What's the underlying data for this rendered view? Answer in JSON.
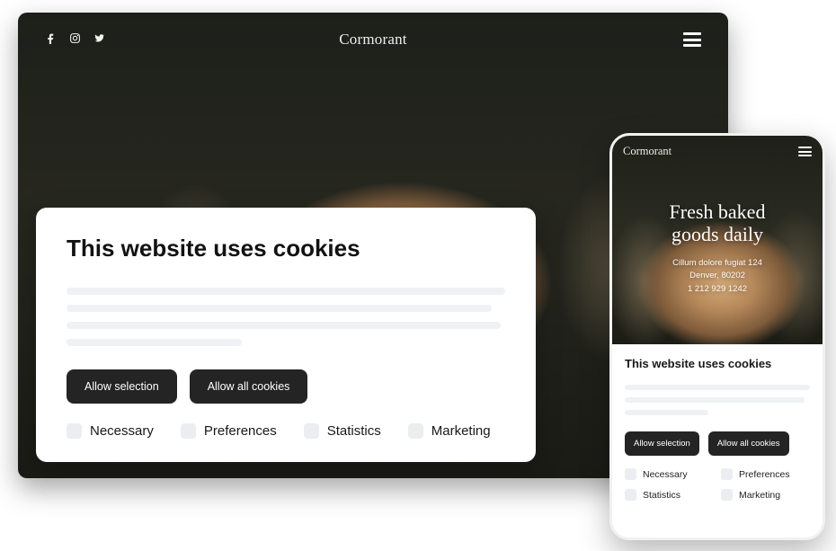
{
  "desktop": {
    "site_title": "Cormorant",
    "cookie": {
      "title": "This website uses cookies",
      "allow_selection": "Allow selection",
      "allow_all": "Allow all cookies",
      "categories": [
        "Necessary",
        "Preferences",
        "Statistics",
        "Marketing"
      ]
    }
  },
  "mobile": {
    "site_title": "Cormorant",
    "hero": {
      "line1": "Fresh baked",
      "line2": "goods daily",
      "address": "Cillum dolore fugiat 124",
      "city": "Denver, 80202",
      "phone": "1 212 929 1242"
    },
    "cookie": {
      "title": "This website uses cookies",
      "allow_selection": "Allow selection",
      "allow_all": "Allow all cookies",
      "categories": [
        "Necessary",
        "Preferences",
        "Statistics",
        "Marketing"
      ]
    }
  }
}
